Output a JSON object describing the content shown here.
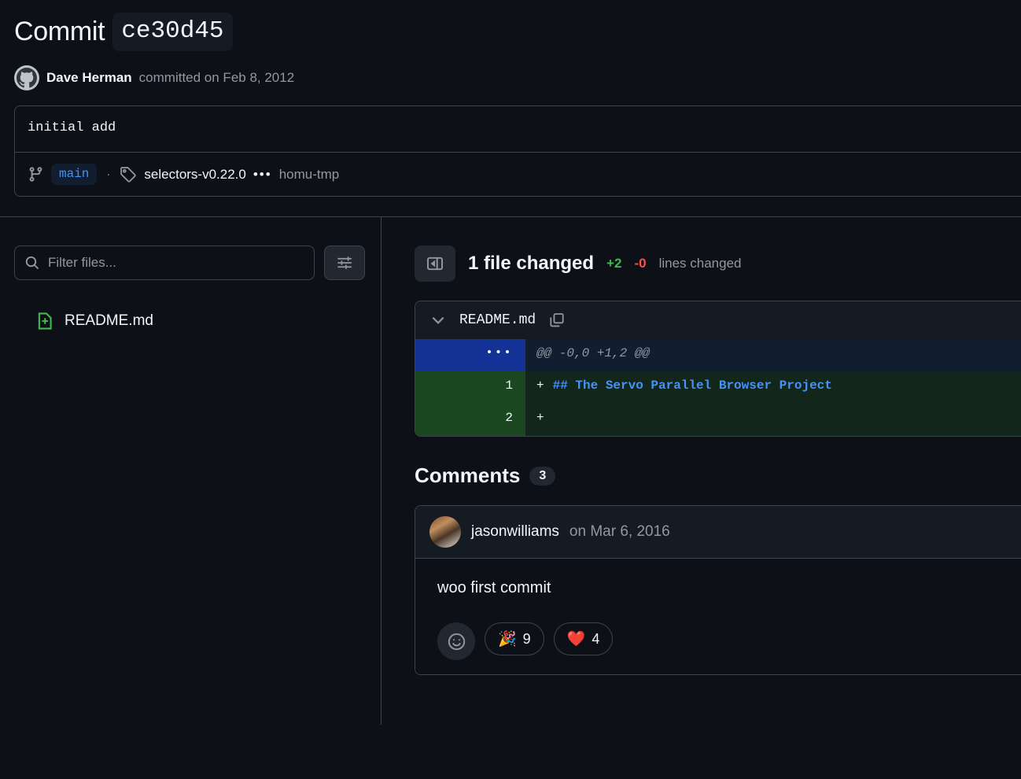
{
  "header": {
    "title_word": "Commit",
    "sha": "ce30d45",
    "author_avatar": "github-logo-avatar",
    "author_name": "Dave Herman",
    "committed_meta": "committed on Feb 8, 2012"
  },
  "commit_message": {
    "text": "initial add",
    "branch_icon": "git-branch-icon",
    "branch": "main",
    "separator": "·",
    "tag_icon": "tag-icon",
    "tag": "selectors-v0.22.0",
    "ellipsis": "•••",
    "extra_ref": "homu-tmp"
  },
  "sidebar": {
    "search_icon": "search-icon",
    "filter_placeholder": "Filter files...",
    "filter_value": "",
    "sliders_icon": "sliders-icon",
    "files": [
      {
        "name": "README.md",
        "status_icon": "file-added-icon"
      }
    ]
  },
  "main": {
    "collapse_icon": "sidebar-collapse-icon",
    "files_changed_label": "1 file changed",
    "additions": "+2",
    "deletions": "-0",
    "lines_changed_label": "lines changed",
    "diff": {
      "chevron_icon": "chevron-down-icon",
      "file_name": "README.md",
      "copy_icon": "copy-icon",
      "rows": [
        {
          "type": "hunk",
          "gutter": "•••",
          "sign": "",
          "text": "@@ -0,0 +1,2 @@"
        },
        {
          "type": "add",
          "gutter": "1",
          "sign": "+",
          "text": "## The Servo Parallel Browser Project"
        },
        {
          "type": "add",
          "gutter": "2",
          "sign": "+",
          "text": ""
        }
      ]
    },
    "comments": {
      "title": "Comments",
      "count": "3",
      "items": [
        {
          "avatar": "user-photo-avatar",
          "user": "jasonwilliams",
          "date": "on Mar 6, 2016",
          "body": "woo first commit",
          "add_reaction_icon": "smiley-icon",
          "reactions": [
            {
              "emoji": "🎉",
              "count": "9"
            },
            {
              "emoji": "❤️",
              "count": "4"
            }
          ]
        }
      ]
    }
  },
  "colors": {
    "page_bg": "#0d1117",
    "panel_bg": "#151b23",
    "border": "#3d444d",
    "text": "#f0f6fc",
    "muted": "#9198a1",
    "accent_blue": "#4493f8",
    "add_green": "#3fb950",
    "del_red": "#f85149",
    "hunk_gutter": "#143196",
    "add_gutter": "#1b4721"
  }
}
